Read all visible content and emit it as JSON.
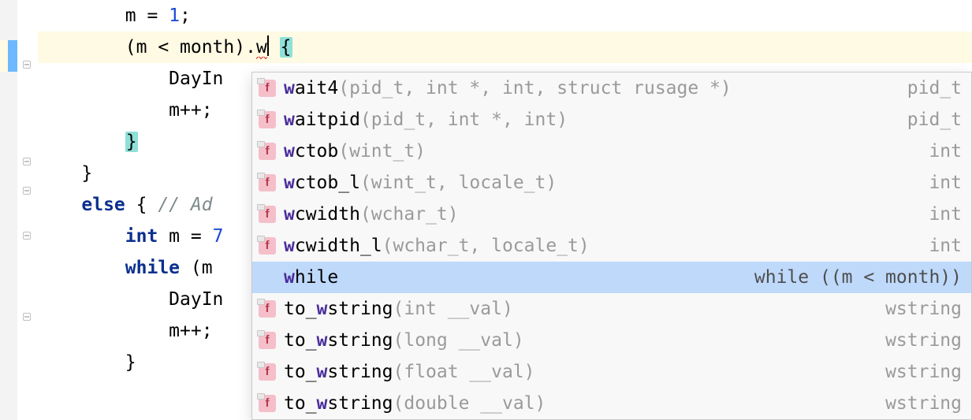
{
  "code": {
    "l1": "        m = ",
    "l1_num": "1",
    "l1_suffix": ";",
    "l2_prefix": "        (m < month).",
    "l2_typed": "w",
    "l2_brace": "{",
    "l3": "            DayIn",
    "l4": "            m++;",
    "l5_brace": "}",
    "l6": "    }",
    "l7_a": "    ",
    "l7_kw": "else",
    "l7_b": " { ",
    "l7_cmt": "// Ad",
    "l8_a": "        ",
    "l8_kw": "int",
    "l8_b": " m = ",
    "l8_num": "7",
    "l9_a": "        ",
    "l9_kw": "while",
    "l9_b": " (m ",
    "l10": "            DayIn",
    "l11": "            m++;",
    "l12": "        }"
  },
  "popup": {
    "items": [
      {
        "kind": "f",
        "prefix": "w",
        "name": "ait4",
        "params": "(pid_t, int *, int, struct rusage *)",
        "rtype": "pid_t",
        "selected": false
      },
      {
        "kind": "f",
        "prefix": "w",
        "name": "aitpid",
        "params": "(pid_t, int *, int)",
        "rtype": "pid_t",
        "selected": false
      },
      {
        "kind": "f",
        "prefix": "w",
        "name": "ctob",
        "params": "(wint_t)",
        "rtype": "int",
        "selected": false
      },
      {
        "kind": "f",
        "prefix": "w",
        "name": "ctob_l",
        "params": "(wint_t, locale_t)",
        "rtype": "int",
        "selected": false
      },
      {
        "kind": "f",
        "prefix": "w",
        "name": "cwidth",
        "params": "(wchar_t)",
        "rtype": "int",
        "selected": false
      },
      {
        "kind": "f",
        "prefix": "w",
        "name": "cwidth_l",
        "params": "(wchar_t, locale_t)",
        "rtype": "int",
        "selected": false
      },
      {
        "kind": "",
        "prefix": "w",
        "name": "hile",
        "params": "",
        "rtype": "while ((m < month))",
        "selected": true
      },
      {
        "kind": "f",
        "prefix": "",
        "name": "to_",
        "mid_hit": "w",
        "rest": "string",
        "params": "(int __val)",
        "rtype": "wstring",
        "selected": false
      },
      {
        "kind": "f",
        "prefix": "",
        "name": "to_",
        "mid_hit": "w",
        "rest": "string",
        "params": "(long __val)",
        "rtype": "wstring",
        "selected": false
      },
      {
        "kind": "f",
        "prefix": "",
        "name": "to_",
        "mid_hit": "w",
        "rest": "string",
        "params": "(float __val)",
        "rtype": "wstring",
        "selected": false
      },
      {
        "kind": "f",
        "prefix": "",
        "name": "to_",
        "mid_hit": "w",
        "rest": "string",
        "params": "(double __val)",
        "rtype": "wstring",
        "selected": false
      }
    ]
  }
}
